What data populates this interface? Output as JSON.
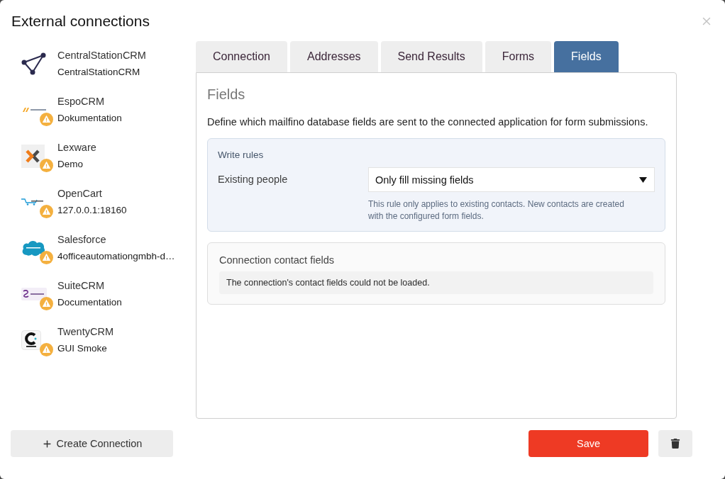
{
  "dialog": {
    "title": "External connections"
  },
  "connections": [
    {
      "name": "CentralStationCRM",
      "detail": "CentralStationCRM",
      "kind": "network",
      "warning": false
    },
    {
      "name": "EspoCRM",
      "detail": "Dokumentation",
      "kind": "espo",
      "warning": true
    },
    {
      "name": "Lexware",
      "detail": "Demo",
      "kind": "lexware",
      "warning": true
    },
    {
      "name": "OpenCart",
      "detail": "127.0.0.1:18160",
      "kind": "opencart",
      "warning": true
    },
    {
      "name": "Salesforce",
      "detail": "4officeautomationgmbh-d…",
      "kind": "salesforce",
      "warning": true
    },
    {
      "name": "SuiteCRM",
      "detail": "Documentation",
      "kind": "suite",
      "warning": true
    },
    {
      "name": "TwentyCRM",
      "detail": "GUI Smoke",
      "kind": "twenty",
      "warning": true
    }
  ],
  "tabs": [
    {
      "label": "Connection",
      "selected": false
    },
    {
      "label": "Addresses",
      "selected": false
    },
    {
      "label": "Send Results",
      "selected": false
    },
    {
      "label": "Forms",
      "selected": false
    },
    {
      "label": "Fields",
      "selected": true
    }
  ],
  "panel": {
    "title": "Fields",
    "description": "Define which mailfino database fields are sent to the connected application for form submissions.",
    "write_rules": {
      "title": "Write rules",
      "label": "Existing people",
      "value": "Only fill missing fields",
      "help": "This rule only applies to existing contacts. New contacts are created with the configured form fields."
    },
    "contact_fields": {
      "title": "Connection contact fields",
      "message": "The connection's contact fields could not be loaded."
    }
  },
  "footer": {
    "create_button": "Create Connection",
    "save_button": "Save"
  }
}
